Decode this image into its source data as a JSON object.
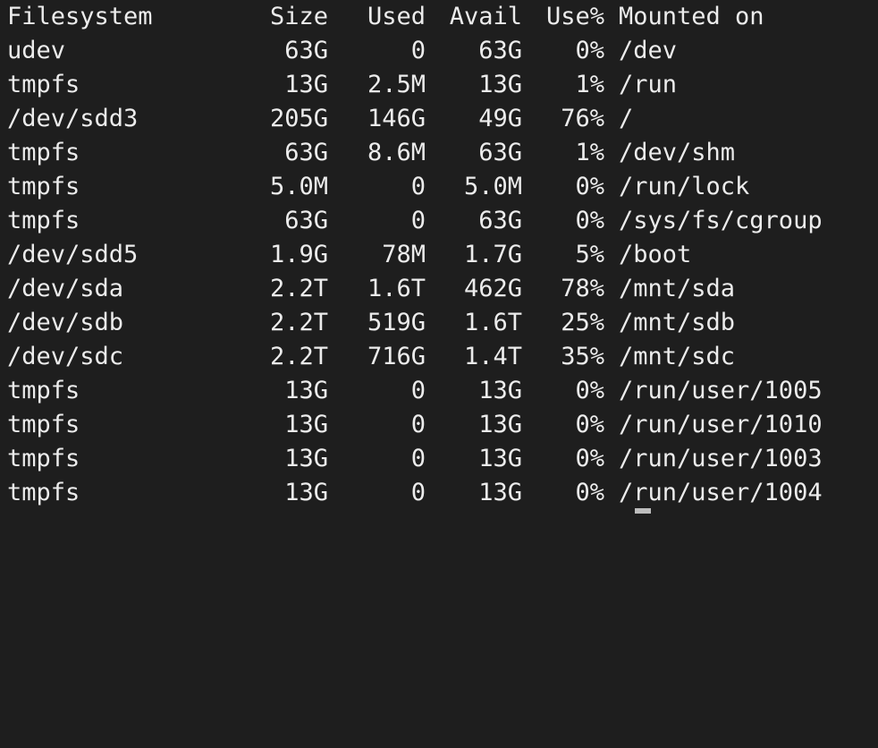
{
  "header": [
    "Filesystem",
    "Size",
    "Used",
    "Avail",
    "Use%",
    "Mounted on"
  ],
  "rows": [
    [
      "udev",
      "63G",
      "0",
      "63G",
      "0%",
      "/dev"
    ],
    [
      "tmpfs",
      "13G",
      "2.5M",
      "13G",
      "1%",
      "/run"
    ],
    [
      "/dev/sdd3",
      "205G",
      "146G",
      "49G",
      "76%",
      "/"
    ],
    [
      "tmpfs",
      "63G",
      "8.6M",
      "63G",
      "1%",
      "/dev/shm"
    ],
    [
      "tmpfs",
      "5.0M",
      "0",
      "5.0M",
      "0%",
      "/run/lock"
    ],
    [
      "tmpfs",
      "63G",
      "0",
      "63G",
      "0%",
      "/sys/fs/cgroup"
    ],
    [
      "/dev/sdd5",
      "1.9G",
      "78M",
      "1.7G",
      "5%",
      "/boot"
    ],
    [
      "/dev/sda",
      "2.2T",
      "1.6T",
      "462G",
      "78%",
      "/mnt/sda"
    ],
    [
      "/dev/sdb",
      "2.2T",
      "519G",
      "1.6T",
      "25%",
      "/mnt/sdb"
    ],
    [
      "/dev/sdc",
      "2.2T",
      "716G",
      "1.4T",
      "35%",
      "/mnt/sdc"
    ],
    [
      "tmpfs",
      "13G",
      "0",
      "13G",
      "0%",
      "/run/user/1005"
    ],
    [
      "tmpfs",
      "13G",
      "0",
      "13G",
      "0%",
      "/run/user/1010"
    ],
    [
      "tmpfs",
      "13G",
      "0",
      "13G",
      "0%",
      "/run/user/1003"
    ],
    [
      "tmpfs",
      "13G",
      "0",
      "13G",
      "0%",
      "/run/user/1004"
    ]
  ],
  "colors": {
    "background": "#1e1e1e",
    "text": "#ececec",
    "cursor": "#bdbdbd"
  }
}
